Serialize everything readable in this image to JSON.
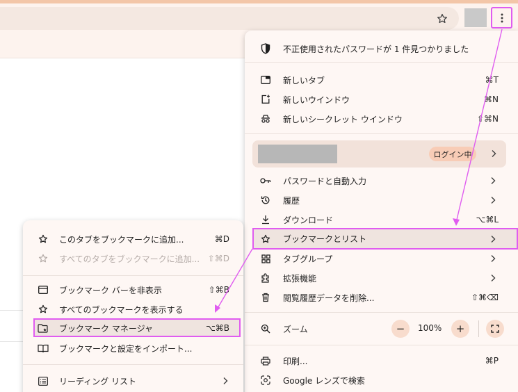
{
  "colors": {
    "accent_magenta": "#e05cf0",
    "menu_bg": "#fef7f4",
    "highlight_bg": "#efe4df",
    "pill_bg": "#f8ccb6"
  },
  "main_menu": {
    "password_alert": "不正使用されたパスワードが 1 件見つかりました",
    "new_tab": {
      "label": "新しいタブ",
      "shortcut": "⌘T"
    },
    "new_window": {
      "label": "新しいウインドウ",
      "shortcut": "⌘N"
    },
    "new_incognito": {
      "label": "新しいシークレット ウインドウ",
      "shortcut": "⇧⌘N"
    },
    "profile": {
      "login_label": "ログイン中"
    },
    "passwords": {
      "label": "パスワードと自動入力"
    },
    "history": {
      "label": "履歴"
    },
    "downloads": {
      "label": "ダウンロード",
      "shortcut": "⌥⌘L"
    },
    "bookmarks": {
      "label": "ブックマークとリスト"
    },
    "tab_groups": {
      "label": "タブグループ"
    },
    "extensions": {
      "label": "拡張機能"
    },
    "clear_data": {
      "label": "閲覧履歴データを削除...",
      "shortcut": "⇧⌘⌫"
    },
    "zoom": {
      "label": "ズーム",
      "value": "100%",
      "minus": "−",
      "plus": "+"
    },
    "print": {
      "label": "印刷...",
      "shortcut": "⌘P"
    },
    "google_lens": {
      "label": "Google レンズで検索"
    }
  },
  "sub_menu": {
    "bookmark_tab": {
      "label": "このタブをブックマークに追加...",
      "shortcut": "⌘D"
    },
    "bookmark_all_tabs": {
      "label": "すべてのタブをブックマークに追加...",
      "shortcut": "⇧⌘D"
    },
    "hide_bar": {
      "label": "ブックマーク バーを非表示",
      "shortcut": "⇧⌘B"
    },
    "show_all": {
      "label": "すべてのブックマークを表示する"
    },
    "manager": {
      "label": "ブックマーク マネージャ",
      "shortcut": "⌥⌘B"
    },
    "import": {
      "label": "ブックマークと設定をインポート..."
    },
    "reading_list": {
      "label": "リーディング リスト"
    }
  }
}
